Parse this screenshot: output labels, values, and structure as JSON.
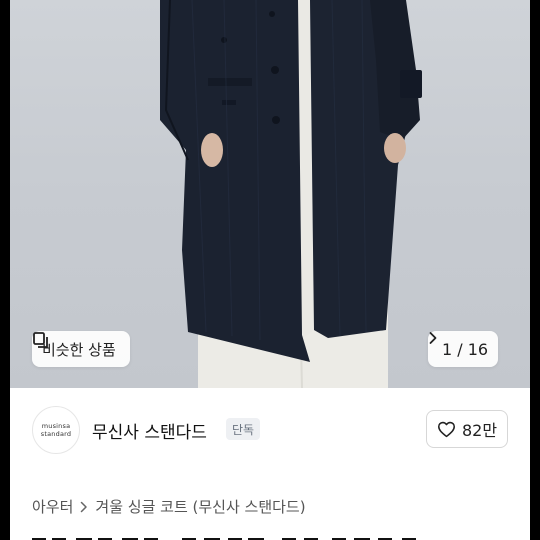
{
  "product_image": {
    "similar_button_label": "비슷한 상품",
    "pager_text": "1 / 16"
  },
  "brand": {
    "logo_line1": "musinsa",
    "logo_line2": "standard",
    "name": "무신사 스탠다드",
    "tag": "단독"
  },
  "like": {
    "count": "82만"
  },
  "breadcrumb": {
    "category": "아우터",
    "item": "겨울 싱글 코트 (무신사 스탠다드)"
  },
  "colors": {
    "coat": "#1b2230",
    "trousers": "#ecebe6",
    "photo_bg": "#c9cdd3"
  },
  "icons": [
    "copy-icon",
    "chevron-right-icon",
    "heart-icon"
  ]
}
